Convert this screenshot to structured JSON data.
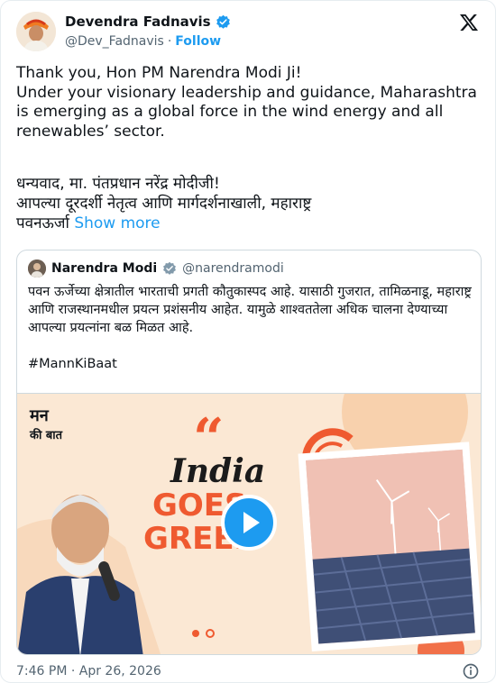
{
  "author": {
    "name": "Devendra Fadnavis",
    "handle": "@Dev_Fadnavis",
    "separator": "·",
    "follow_label": "Follow"
  },
  "tweet": {
    "text_en": "Thank you, Hon PM Narendra Modi Ji!\nUnder your visionary leadership and guidance, Maharashtra is emerging as a global force in the wind energy and all renewables’ sector.",
    "text_mr": "धन्यवाद, मा. पंतप्रधान नरेंद्र मोदीजी!\nआपल्या दूरदर्शी नेतृत्व आणि मार्गदर्शनाखाली, महाराष्ट्र\nपवनऊर्जा",
    "show_more": "Show more",
    "timestamp": "7:46 PM · Apr 26, 2026"
  },
  "quoted": {
    "name": "Narendra Modi",
    "handle": "@narendramodi",
    "text": "पवन ऊर्जेच्या क्षेत्रातील भारताची प्रगती कौतुकास्पद आहे. यासाठी गुजरात, तामिळनाडू, महाराष्ट्र आणि राजस्थानमधील प्रयत्न प्रशंसनीय  आहेत. यामुळे शाश्वततेला अधिक चालना देण्याच्या आपल्या प्रयत्नांना बळ मिळत आहे.",
    "hashtag": "#MannKiBaat",
    "media": {
      "logo_line1": "मन",
      "logo_line2": "की बात",
      "title_line1": "India",
      "title_line2": "GOES",
      "title_line3": "GREEN"
    }
  },
  "colors": {
    "accent": "#1d9bf0",
    "verified": "#1d9bf0",
    "media_bg": "#fbe8d4",
    "title_orange": "#ef5a30"
  },
  "icons": {
    "verified": "verified-badge-icon",
    "x_logo": "x-logo-icon",
    "play": "play-icon",
    "info": "info-icon"
  }
}
